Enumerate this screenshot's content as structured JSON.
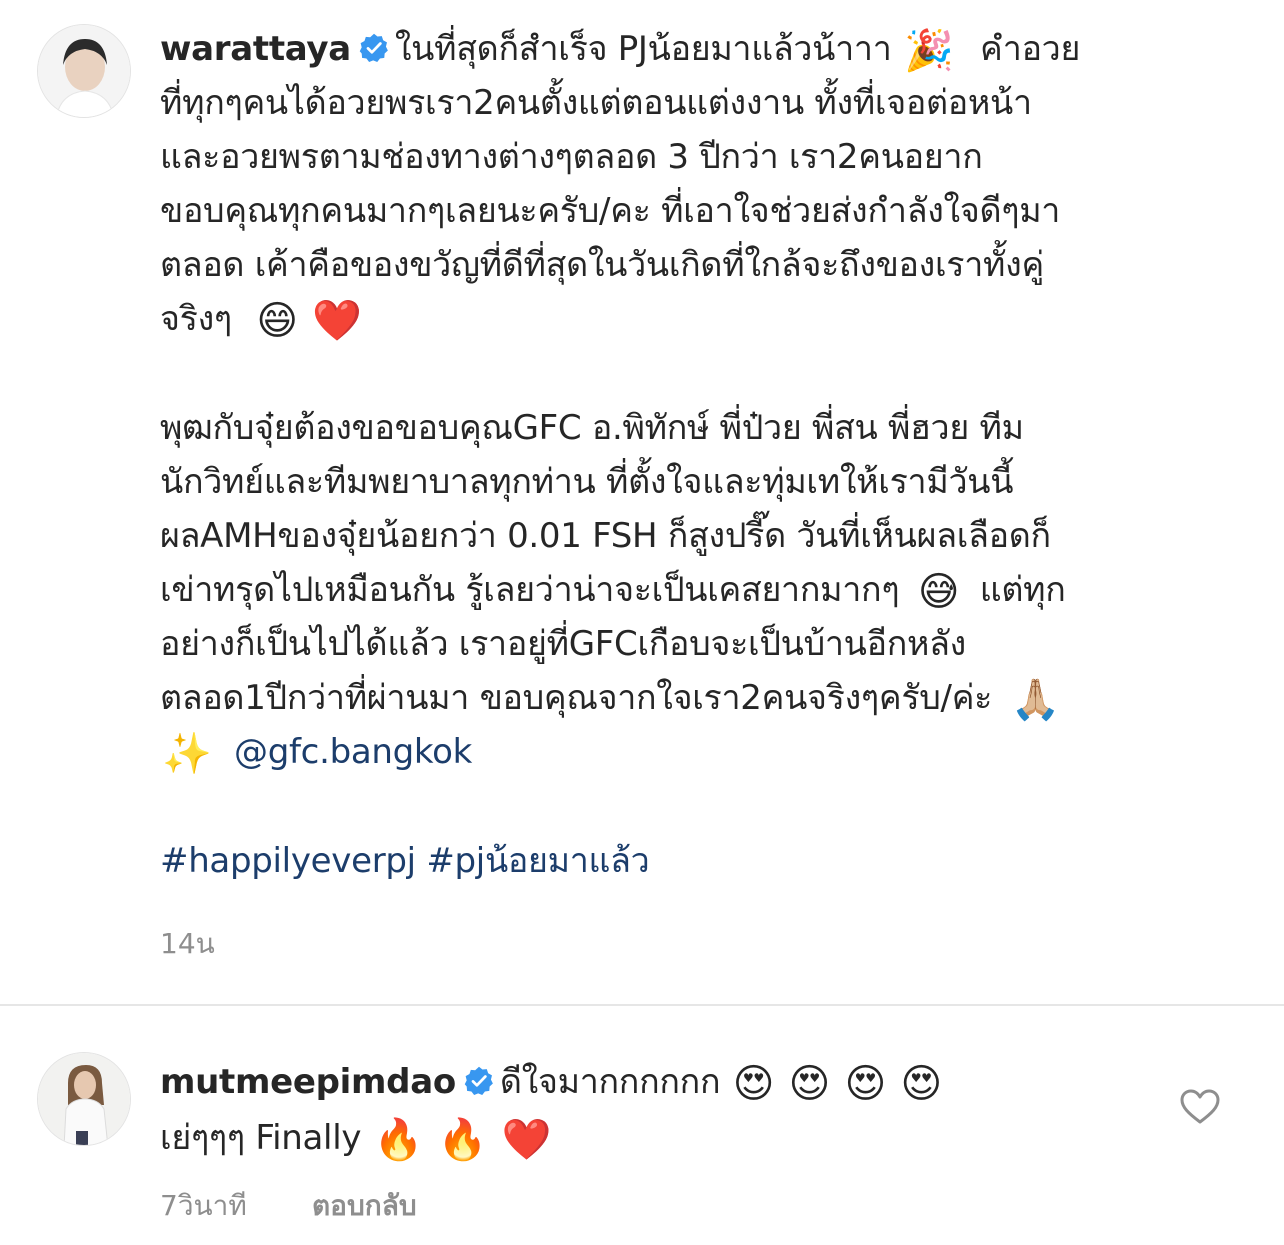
{
  "post": {
    "username": "warattaya",
    "lines": [
      "ในที่สุดก็สำเร็จ PJน้อยมาแล้วน้าาา",
      "คำอวย",
      "ที่ทุกๆคนได้อวยพรเรา2คนตั้งแต่ตอนแต่งงาน ทั้งที่เจอต่อหน้า",
      "และอวยพรตามช่องทางต่างๆตลอด 3 ปีกว่า เรา2คนอยาก",
      "ขอบคุณทุกคนมากๆเลยนะครับ/คะ ที่เอาใจช่วยส่งกำลังใจดีๆมา",
      "ตลอด เค้าคือของขวัญที่ดีที่สุดในวันเกิดที่ใกล้จะถึงของเราทั้งคู่",
      "จริงๆ",
      "พุฒกับจุ๋ยต้องขอขอบคุณGFC อ.พิทักษ์ พี่ป๋วย พี่สน พี่ฮวย ทีม",
      "นักวิทย์และทีมพยาบาลทุกท่าน ที่ตั้งใจและทุ่มเทให้เรามีวันนี้",
      "ผลAMHของจุ๋ยน้อยกว่า 0.01 FSH ก็สูงปรี๊ด วันที่เห็นผลเลือดก็",
      "เข่าทรุดไปเหมือนกัน รู้เลยว่าน่าจะเป็นเคสยากมากๆ",
      "แต่ทุก",
      "อย่างก็เป็นไปได้แล้ว เราอยู่ที่GFCเกือบจะเป็นบ้านอีกหลัง",
      "ตลอด1ปีกว่าที่ผ่านมา ขอบคุณจากใจเรา2คนจริงๆครับ/ค่ะ"
    ],
    "mention": "@gfc.bangkok",
    "hashtags": "#happilyeverpj #pjน้อยมาแล้ว",
    "time": "14น",
    "emojis": {
      "party": "🎉",
      "grin": "😄",
      "heart": "❤️",
      "sweat": "😅",
      "pray": "🙏🏼",
      "sparkles": "✨"
    }
  },
  "comment": {
    "username": "mutmeepimdao",
    "text1": "ดีใจมากกกกกก",
    "text2": "เย่ๆๆๆ Finally",
    "emojis": {
      "heart_eyes": "😍",
      "fire": "🔥",
      "heart": "❤️"
    },
    "time": "7วินาที",
    "reply_label": "ตอบกลับ"
  },
  "colors": {
    "text": "#262626",
    "link": "#1c3d6b",
    "secondary": "#8e8e8e",
    "verified": "#3897f0"
  }
}
